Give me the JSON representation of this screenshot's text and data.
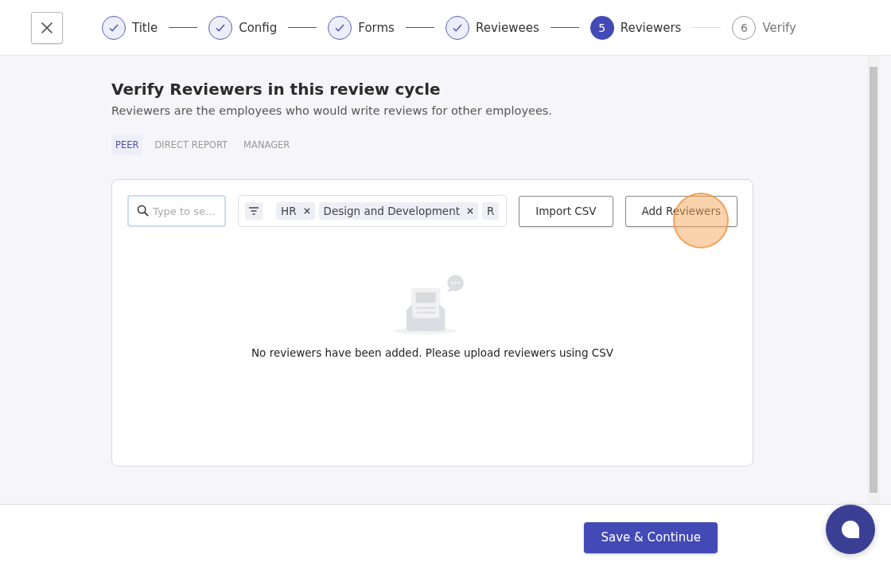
{
  "stepper": [
    {
      "label": "Title",
      "completed": true,
      "selected": false
    },
    {
      "label": "Config",
      "completed": true,
      "selected": false
    },
    {
      "label": "Forms",
      "completed": true,
      "selected": false
    },
    {
      "label": "Reviewees",
      "completed": true,
      "selected": false
    },
    {
      "label": "Reviewers",
      "number": "5",
      "completed": false,
      "selected": true
    },
    {
      "label": "Verify",
      "number": "6",
      "completed": false,
      "selected": false
    }
  ],
  "heading": "Verify Reviewers in this review cycle",
  "subheading": "Reviewers are the employees who would write reviews for other employees.",
  "tabs": [
    {
      "label": "PEER",
      "selected": true
    },
    {
      "label": "DIRECT REPORT",
      "selected": false
    },
    {
      "label": "MANAGER",
      "selected": false
    }
  ],
  "search": {
    "placeholder": "Type to se..."
  },
  "filters": [
    {
      "label": "HR",
      "removable": true
    },
    {
      "label": "Design and Development",
      "removable": true
    },
    {
      "label": "R",
      "removable": false
    }
  ],
  "buttons": [
    "Import CSV",
    "Add Reviewers"
  ],
  "empty_message": "No reviewers have been added. Please upload reviewers using CSV",
  "save_button": "Save & Continue"
}
